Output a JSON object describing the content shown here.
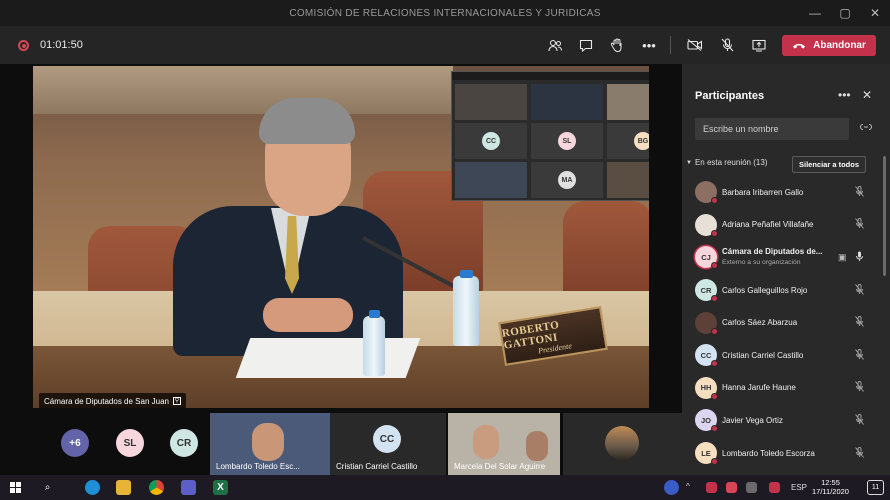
{
  "window": {
    "title": "COMISIÓN DE RELACIONES INTERNACIONALES Y JURIDICAS",
    "controls": [
      "—",
      "▢",
      "✕"
    ]
  },
  "toolbar": {
    "timer": "01:01:50",
    "leave_label": "Abandonar",
    "icons": [
      "participants-icon",
      "chat-icon",
      "raise-hand-icon",
      "more-icon",
      "camera-off-icon",
      "mic-off-icon",
      "share-icon"
    ]
  },
  "stage": {
    "nameplate_name": "ROBERTO GATTONI",
    "nameplate_role": "Presidente",
    "speaker_label": "Cámara de Diputados de San Juan",
    "pip_avatars": [
      "CC",
      "SL",
      "BG",
      "MA"
    ],
    "bottom_tiles": {
      "overflow": "+6",
      "avatars": [
        "SL",
        "CR"
      ],
      "video_1_name": "Lombardo Toledo Esc...",
      "tile_avatar": "CC",
      "tile_avatar_name": "Cristian Carriel Castillo",
      "video_2_name": "Marcela Del Solar Aguirre"
    }
  },
  "panel": {
    "title": "Participantes",
    "search_placeholder": "Escribe un nombre",
    "section_label": "En esta reunión (13)",
    "mute_all_label": "Silenciar a todos",
    "participants": [
      {
        "initials": "",
        "name": "Barbara Iribarren Gallo",
        "color": "#8d6e63",
        "photo": true
      },
      {
        "initials": "",
        "name": "Adriana Peñafiel Villafañe",
        "color": "#e7e0d8",
        "photo": true
      },
      {
        "initials": "CJ",
        "name": "Cámara de Diputados de...",
        "sub": "Externo a su organización",
        "color": "#f7d7dd"
      },
      {
        "initials": "CR",
        "name": "Carlos Galleguillos Rojo",
        "color": "#cfe7e3"
      },
      {
        "initials": "",
        "name": "Carlos Sáez Abarzua",
        "color": "#5d4037",
        "photo": true
      },
      {
        "initials": "CC",
        "name": "Cristian Carriel Castillo",
        "color": "#d3e3f1"
      },
      {
        "initials": "HH",
        "name": "Hanna Jarufe Haune",
        "color": "#f5dfc0"
      },
      {
        "initials": "JO",
        "name": "Javier Vega Ortiz",
        "color": "#dcd5f0"
      },
      {
        "initials": "LE",
        "name": "Lombardo Toledo Escorza",
        "color": "#f5dfc0"
      }
    ]
  },
  "taskbar": {
    "lang": "ESP",
    "time": "12:55",
    "date": "17/11/2020",
    "notifications": "11"
  },
  "colors": {
    "leave": "#c4314b",
    "panel_bg": "#292929",
    "toolbar_bg": "#252525"
  }
}
